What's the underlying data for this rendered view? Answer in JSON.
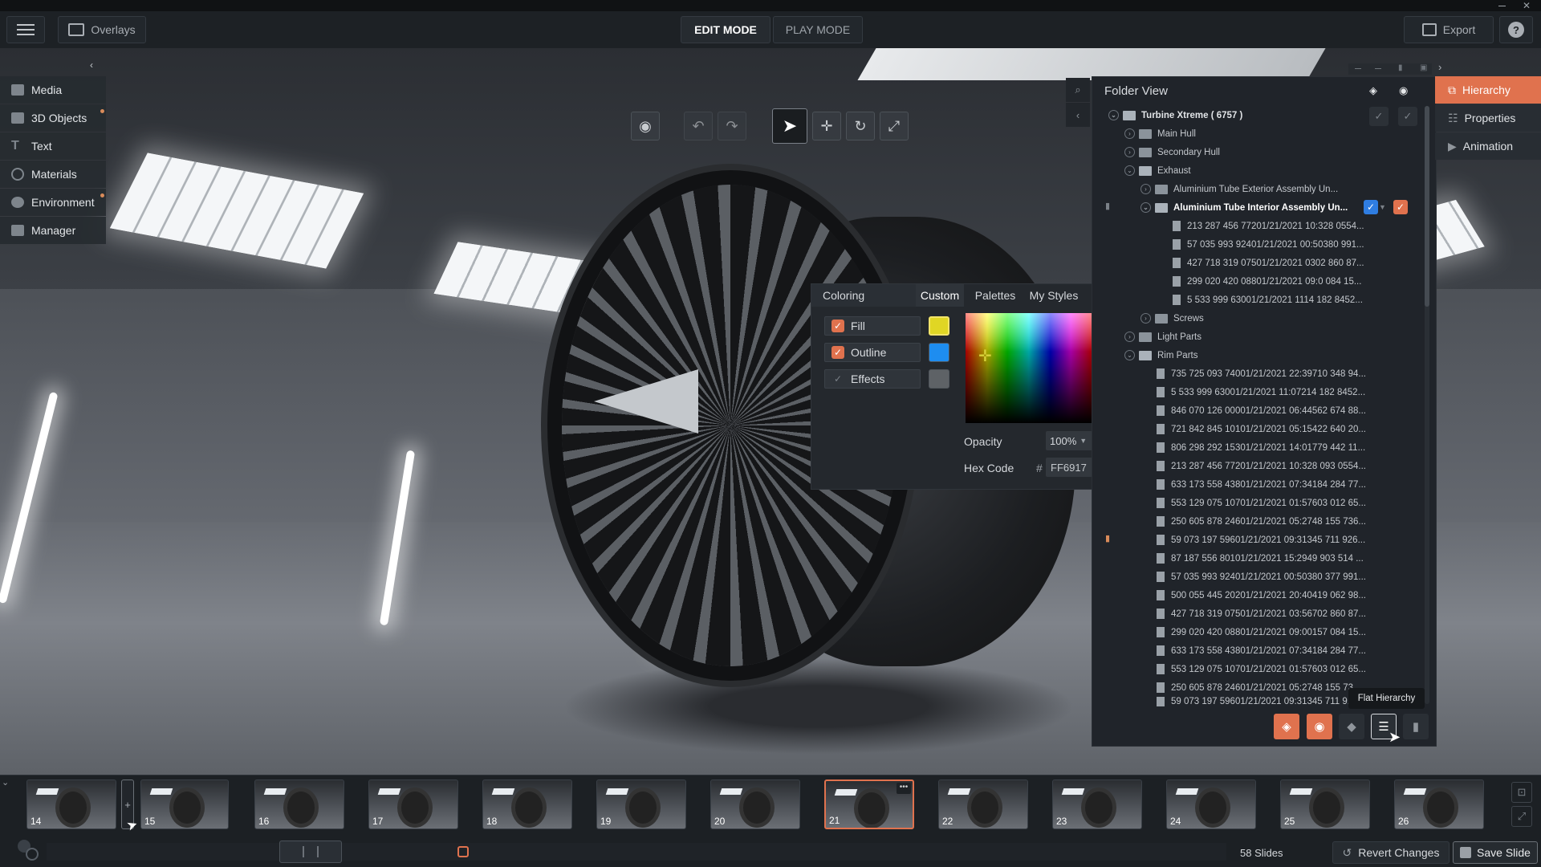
{
  "topbar": {
    "overlays_label": "Overlays",
    "edit_mode_label": "EDIT MODE",
    "play_mode_label": "PLAY MODE",
    "export_label": "Export",
    "help_label": "?"
  },
  "left_menu": {
    "items": [
      {
        "label": "Media",
        "icon": "media-icon"
      },
      {
        "label": "3D Objects",
        "icon": "cube-icon"
      },
      {
        "label": "Text",
        "icon": "text-icon"
      },
      {
        "label": "Materials",
        "icon": "materials-icon"
      },
      {
        "label": "Environment",
        "icon": "environment-icon"
      },
      {
        "label": "Manager",
        "icon": "manager-icon"
      }
    ]
  },
  "coloring": {
    "title": "Coloring",
    "tabs": [
      "Custom",
      "Palettes",
      "My Styles"
    ],
    "active_tab": "Custom",
    "rows": [
      {
        "label": "Fill",
        "checked": true,
        "color": "#e0d624"
      },
      {
        "label": "Outline",
        "checked": true,
        "color": "#1e8df0"
      },
      {
        "label": "Effects",
        "checked": false,
        "color": "#5e6266"
      }
    ],
    "opacity_label": "Opacity",
    "opacity_value": "100%",
    "hex_label": "Hex Code",
    "hex_prefix": "#",
    "hex_value": "FF6917"
  },
  "hierarchy": {
    "title": "Folder View",
    "rows": [
      {
        "label": "Turbine Xtreme ( 6757 )"
      },
      {
        "label": "Main Hull"
      },
      {
        "label": "Secondary Hull"
      },
      {
        "label": "Exhaust"
      },
      {
        "label": "Aluminium Tube Exterior Assembly Un..."
      },
      {
        "label": "Aluminium Tube Interior Assembly Un..."
      },
      {
        "label": "213 287 456 77201/21/2021 10:328 0554..."
      },
      {
        "label": "57 035 993 92401/21/2021 00:50380 991..."
      },
      {
        "label": "427 718 319 07501/21/2021 0302 860 87..."
      },
      {
        "label": "299 020 420 08801/21/2021 09:0 084 15..."
      },
      {
        "label": "5 533 999 63001/21/2021 1114 182 8452..."
      },
      {
        "label": "Screws"
      },
      {
        "label": "Light Parts"
      },
      {
        "label": "Rim Parts"
      },
      {
        "label": "735 725 093 74001/21/2021 22:39710 348 94..."
      },
      {
        "label": "5 533 999 63001/21/2021 11:07214 182 8452..."
      },
      {
        "label": "846 070 126 00001/21/2021 06:44562 674 88..."
      },
      {
        "label": "721 842 845 10101/21/2021 05:15422 640 20..."
      },
      {
        "label": "806 298 292 15301/21/2021 14:01779 442 11..."
      },
      {
        "label": "213 287 456 77201/21/2021 10:328 093 0554..."
      },
      {
        "label": "633 173 558 43801/21/2021 07:34184 284 77..."
      },
      {
        "label": "553 129 075 10701/21/2021 01:57603 012 65..."
      },
      {
        "label": "250 605 878 24601/21/2021 05:2748 155 736..."
      },
      {
        "label": "59 073 197 59601/21/2021 09:31345 711 926..."
      },
      {
        "label": "87 187 556 80101/21/2021 15:2949 903 514 ..."
      },
      {
        "label": "57 035 993 92401/21/2021 00:50380 377 991..."
      },
      {
        "label": "500 055 445 20201/21/2021 20:40419 062 98..."
      },
      {
        "label": "427 718 319 07501/21/2021 03:56702 860 87..."
      },
      {
        "label": "299 020 420 08801/21/2021 09:00157 084 15..."
      },
      {
        "label": "633 173 558 43801/21/2021 07:34184 284 77..."
      },
      {
        "label": "553 129 075 10701/21/2021 01:57603 012 65..."
      },
      {
        "label": "250 605 878 24601/21/2021 05:2748 155 73..."
      },
      {
        "label": "59 073 197 59601/21/2021 09:31345 711 9..."
      }
    ],
    "tooltip": "Flat Hierarchy"
  },
  "right_tabs": {
    "items": [
      {
        "label": "Hierarchy",
        "icon": "hierarchy-icon"
      },
      {
        "label": "Properties",
        "icon": "properties-icon"
      },
      {
        "label": "Animation",
        "icon": "animation-icon"
      }
    ]
  },
  "timeline": {
    "slides": [
      "14",
      "15",
      "16",
      "17",
      "18",
      "19",
      "20",
      "21",
      "22",
      "23",
      "24",
      "25",
      "26"
    ],
    "selected_slide": "21",
    "slide_count": "58 Slides",
    "revert_label": "Revert Changes",
    "save_label": "Save Slide"
  },
  "colors": {
    "accent": "#e0724e",
    "panel": "#20242a",
    "check_blue": "#2f7de1"
  }
}
